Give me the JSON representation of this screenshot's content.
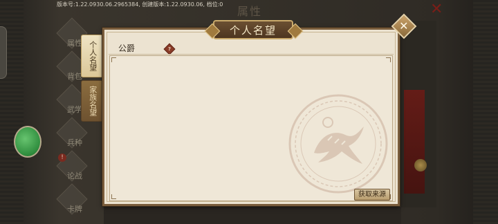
{
  "status_bar": {
    "version_text": "版本号:1.22.0930.06.2965384, 创建版本:1.22.0930.06, 档位:0"
  },
  "background": {
    "title": "属性",
    "close_icon": "close-x-icon",
    "nav_items": [
      {
        "label": "属性",
        "icon": "diamond-icon"
      },
      {
        "label": "背包",
        "icon": "diamond-icon"
      },
      {
        "label": "武学",
        "icon": "diamond-icon"
      },
      {
        "label": "兵种",
        "icon": "diamond-icon"
      },
      {
        "label": "论战",
        "icon": "diamond-icon",
        "alert": "!"
      },
      {
        "label": "卡牌",
        "icon": "diamond-icon"
      }
    ]
  },
  "tabs": [
    {
      "label": "个人名望",
      "active": true
    },
    {
      "label": "家族名望",
      "active": false
    }
  ],
  "modal": {
    "title": "个人名望",
    "section_label": "公爵",
    "help_icon": "?",
    "source_button": "获取来源",
    "close_glyph": "✕"
  },
  "colors": {
    "modal_bg": "#ece3d1",
    "frame_brown": "#7a5d3c",
    "banner_brown": "#4d3520",
    "gold_trim": "#c9a96a",
    "help_red": "#8a3c28"
  }
}
